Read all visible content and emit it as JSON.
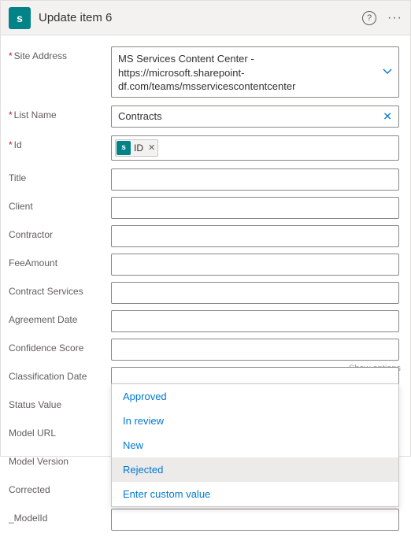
{
  "header": {
    "app_icon_letter": "s",
    "title": "Update item 6",
    "help_label": "?"
  },
  "fields": {
    "site_address": {
      "label": "Site Address",
      "required": true,
      "value": "MS Services Content Center - https://microsoft.sharepoint-df.com/teams/msservicescontentcenter"
    },
    "list_name": {
      "label": "List Name",
      "required": true,
      "value": "Contracts"
    },
    "id": {
      "label": "Id",
      "required": true,
      "token_label": "ID",
      "token_icon": "s"
    },
    "title": {
      "label": "Title",
      "value": ""
    },
    "client": {
      "label": "Client",
      "value": ""
    },
    "contractor": {
      "label": "Contractor",
      "value": ""
    },
    "fee_amount": {
      "label": "FeeAmount",
      "value": ""
    },
    "contract_services": {
      "label": "Contract Services",
      "value": ""
    },
    "agreement_date": {
      "label": "Agreement Date",
      "value": ""
    },
    "confidence_score": {
      "label": "Confidence Score",
      "value": ""
    },
    "classification_date": {
      "label": "Classification Date",
      "value": "",
      "show_options_label": "Show options"
    },
    "status_value": {
      "label": "Status Value",
      "value": "Rejected"
    },
    "model_url": {
      "label": "Model URL",
      "value": ""
    },
    "model_version": {
      "label": "Model Version",
      "value": ""
    },
    "corrected": {
      "label": "Corrected",
      "value": ""
    },
    "model_id": {
      "label": "_ModelId",
      "value": ""
    }
  },
  "dropdown": {
    "items": [
      "Approved",
      "In review",
      "New",
      "Rejected",
      "Enter custom value"
    ],
    "selected": "Rejected"
  }
}
